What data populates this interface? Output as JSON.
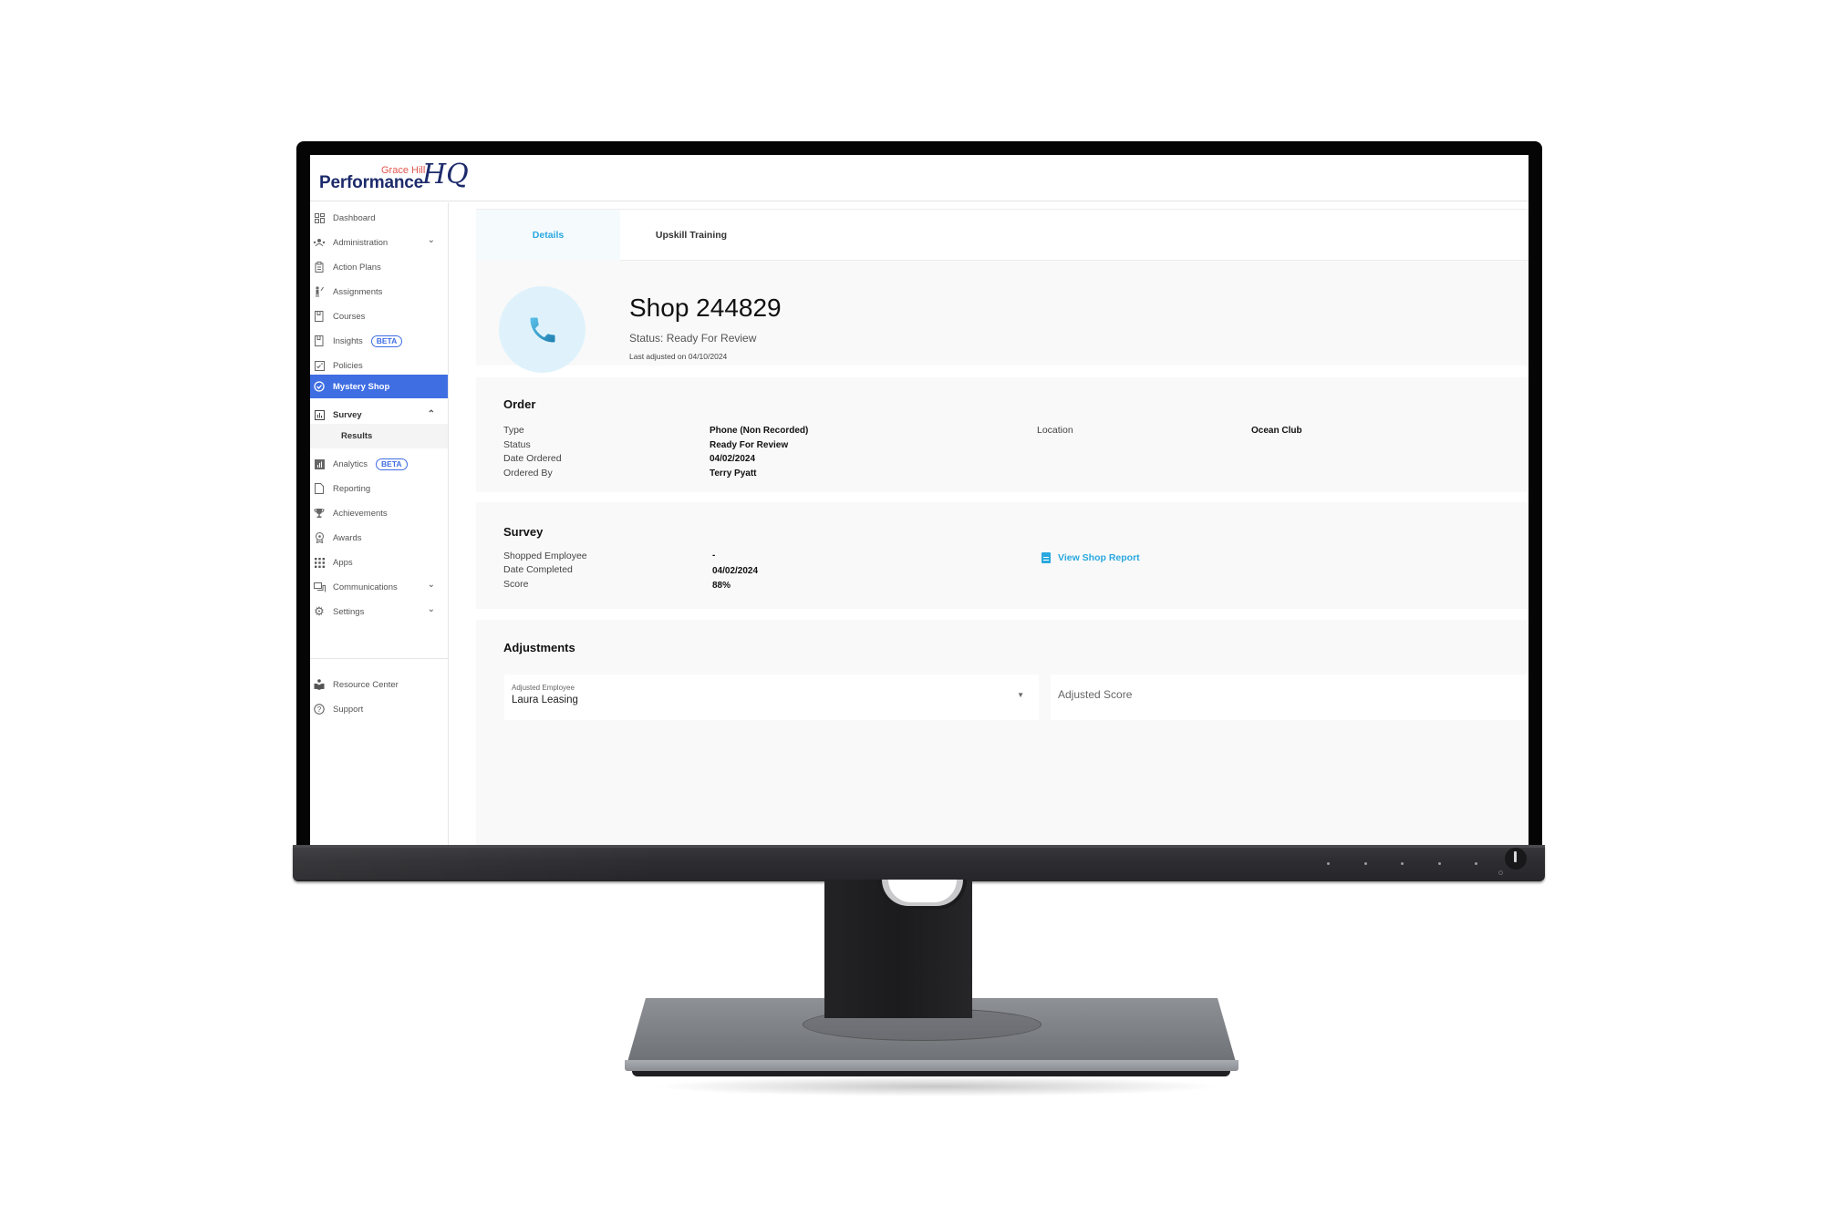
{
  "app": {
    "logo_top": "Grace Hill",
    "logo_main": "Performance",
    "logo_hq": "HQ"
  },
  "sidebar": {
    "items": [
      {
        "label": "Dashboard",
        "icon": "dashboard-grid-icon"
      },
      {
        "label": "Administration",
        "icon": "people-icon",
        "chevron": "down"
      },
      {
        "label": "Action Plans",
        "icon": "clipboard-icon"
      },
      {
        "label": "Assignments",
        "icon": "person-pointer-icon"
      },
      {
        "label": "Courses",
        "icon": "book-icon"
      },
      {
        "label": "Insights",
        "icon": "book-icon",
        "badge": "BETA"
      },
      {
        "label": "Policies",
        "icon": "checklist-icon"
      },
      {
        "label": "Mystery Shop",
        "icon": "check-circle-icon",
        "active": true
      },
      {
        "label": "Survey",
        "icon": "bar-chart-icon",
        "chevron": "up"
      },
      {
        "label": "Results",
        "sub": true
      },
      {
        "label": "Analytics",
        "icon": "analytics-icon",
        "badge": "BETA"
      },
      {
        "label": "Reporting",
        "icon": "document-icon"
      },
      {
        "label": "Achievements",
        "icon": "trophy-icon"
      },
      {
        "label": "Awards",
        "icon": "award-ribbon-icon"
      },
      {
        "label": "Apps",
        "icon": "apps-grid-icon"
      },
      {
        "label": "Communications",
        "icon": "chat-icon",
        "chevron": "down"
      },
      {
        "label": "Settings",
        "icon": "gear-icon",
        "chevron": "down"
      }
    ],
    "footer": [
      {
        "label": "Resource Center",
        "icon": "reading-person-icon"
      },
      {
        "label": "Support",
        "icon": "help-circle-icon"
      }
    ]
  },
  "tabs": [
    {
      "label": "Details",
      "active": true
    },
    {
      "label": "Upskill Training",
      "active": false
    }
  ],
  "hero": {
    "title": "Shop 244829",
    "status": "Status: Ready For Review",
    "last_adjusted": "Last adjusted on 04/10/2024",
    "icon": "phone-icon"
  },
  "order": {
    "title": "Order",
    "fields": [
      {
        "label": "Type",
        "value": "Phone (Non Recorded)"
      },
      {
        "label": "Status",
        "value": "Ready For Review"
      },
      {
        "label": "Date Ordered",
        "value": "04/02/2024"
      },
      {
        "label": "Ordered By",
        "value": "Terry Pyatt"
      }
    ],
    "location_label": "Location",
    "location_value": "Ocean Club"
  },
  "survey": {
    "title": "Survey",
    "fields": [
      {
        "label": "Shopped Employee",
        "value": "-"
      },
      {
        "label": "Date Completed",
        "value": "04/02/2024"
      },
      {
        "label": "Score",
        "value": "88%"
      }
    ],
    "report_link": "View Shop Report"
  },
  "adjustments": {
    "title": "Adjustments",
    "employee_label": "Adjusted Employee",
    "employee_value": "Laura Leasing",
    "score_placeholder": "Adjusted Score"
  },
  "colors": {
    "accent_blue": "#29a8df",
    "active_nav": "#3f6ee3",
    "logo_navy": "#1d2b6b",
    "logo_red": "#e2554e"
  }
}
